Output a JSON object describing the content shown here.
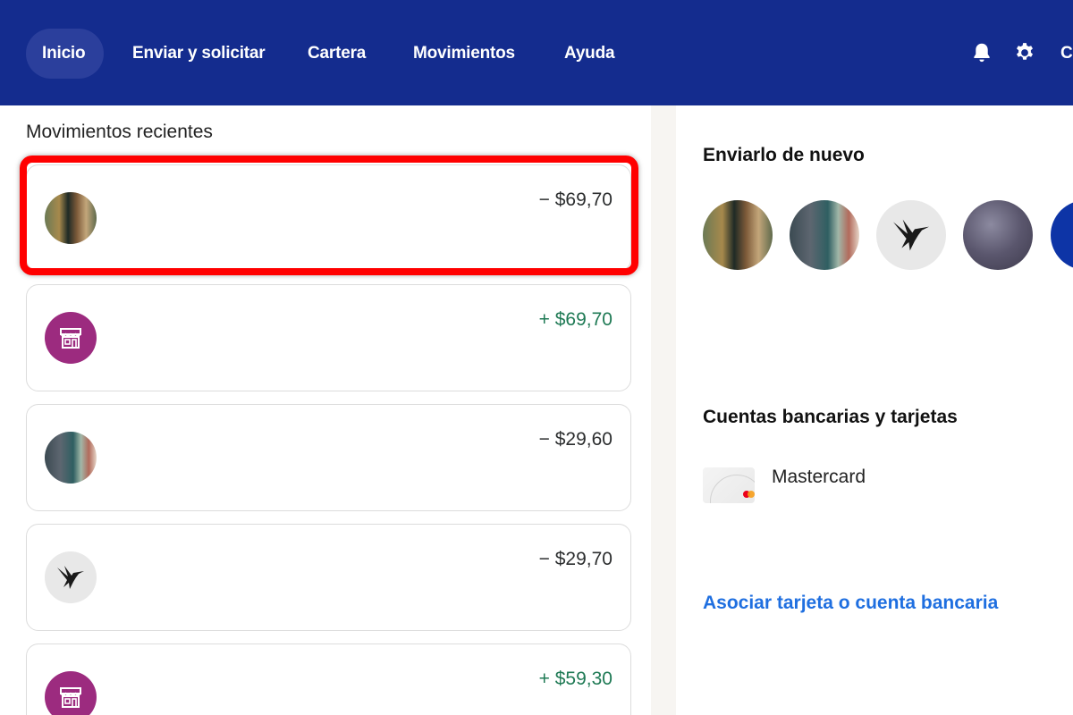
{
  "nav": {
    "items": [
      {
        "label": "Inicio"
      },
      {
        "label": "Enviar y solicitar"
      },
      {
        "label": "Cartera"
      },
      {
        "label": "Movimientos"
      },
      {
        "label": "Ayuda"
      }
    ],
    "truncated_label": "C",
    "icons": [
      "bell-icon",
      "gear-icon"
    ]
  },
  "recent": {
    "title": "Movimientos recientes",
    "transactions": [
      {
        "amount": "− $69,70",
        "direction": "negative",
        "avatar": "photo-couple"
      },
      {
        "amount": "+ $69,70",
        "direction": "positive",
        "avatar": "store-icon"
      },
      {
        "amount": "− $29,60",
        "direction": "negative",
        "avatar": "photo-pair"
      },
      {
        "amount": "− $29,70",
        "direction": "negative",
        "avatar": "hummingbird-icon"
      },
      {
        "amount": "+ $59,30",
        "direction": "positive",
        "avatar": "store-icon"
      }
    ]
  },
  "send_again": {
    "title": "Enviarlo de nuevo",
    "contacts": [
      "photo-couple",
      "photo-pair",
      "hummingbird-icon",
      "dark-photo",
      "blue-badge"
    ]
  },
  "accounts": {
    "title": "Cuentas bancarias y tarjetas",
    "card_name": "Mastercard",
    "add_link": "Asociar tarjeta o cuenta bancaria"
  },
  "colors": {
    "nav_bg": "#142c8e",
    "positive_amount": "#1f7a55",
    "link": "#1f6fe0",
    "store_avatar": "#9c2b7f",
    "highlight": "#ff0000"
  }
}
